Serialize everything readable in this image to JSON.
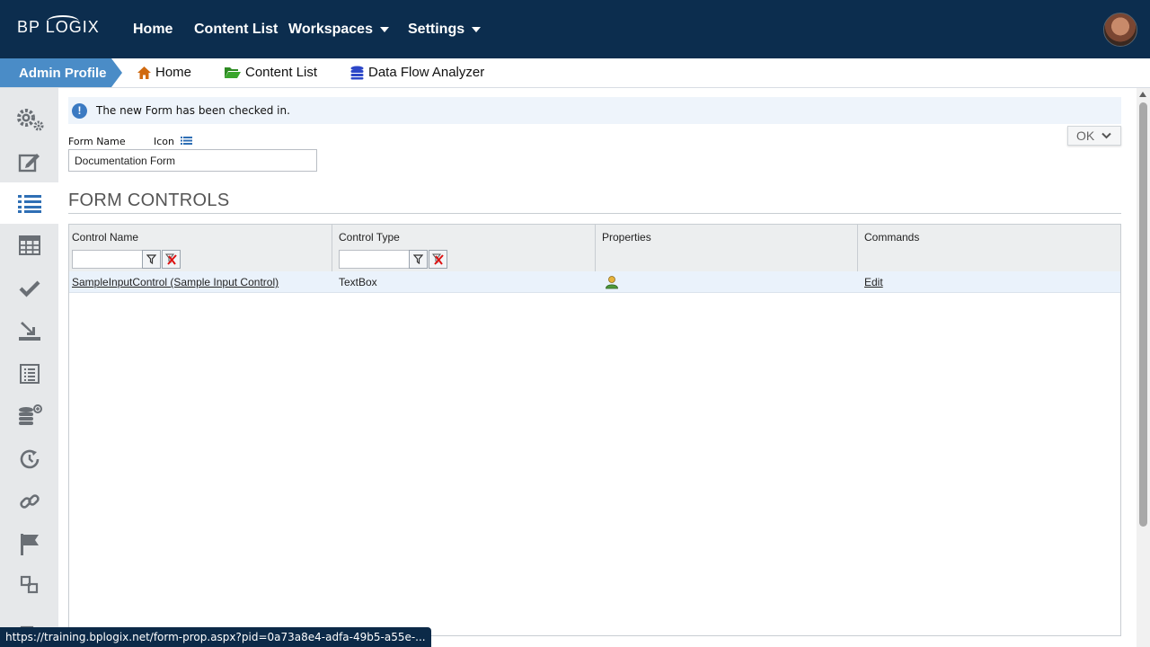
{
  "brand": {
    "logo_text": "BP LOGIX"
  },
  "nav": {
    "home": "Home",
    "content_list": "Content List",
    "workspaces": "Workspaces",
    "settings": "Settings"
  },
  "breadcrumb": {
    "admin_profile": "Admin Profile",
    "home": "Home",
    "content_list": "Content List",
    "data_flow_analyzer": "Data Flow Analyzer"
  },
  "alert": {
    "message": "The new Form has been checked in."
  },
  "form": {
    "name_label": "Form Name",
    "icon_label": "Icon",
    "name_value": "Documentation Form",
    "ok_label": "OK"
  },
  "section": {
    "title": "FORM CONTROLS"
  },
  "grid": {
    "columns": [
      "Control Name",
      "Control Type",
      "Properties",
      "Commands"
    ],
    "rows": [
      {
        "control_name": "SampleInputControl (Sample Input Control)",
        "control_type": "TextBox",
        "command": "Edit"
      }
    ]
  },
  "status_url": "https://training.bplogix.net/form-prop.aspx?pid=0a73a8e4-adfa-49b5-a55e-...",
  "colors": {
    "topbar": "#0c2d4e",
    "admin_tab": "#4a8cc7",
    "home_icon": "#d06a10",
    "folder_icon": "#2e8b23",
    "dataflow_icon": "#2d47c8"
  }
}
